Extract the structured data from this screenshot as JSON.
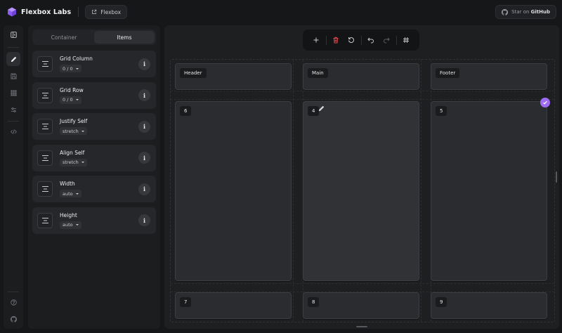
{
  "app": {
    "name": "Flexbox Labs",
    "breadcrumb": "Flexbox"
  },
  "github": {
    "prefix": "Star on ",
    "name": "GitHub"
  },
  "rail": {
    "items": [
      {
        "icon": "panel-toggle-icon"
      },
      {
        "icon": "pencil-icon",
        "active": true
      },
      {
        "icon": "save-icon"
      },
      {
        "icon": "grid-icon"
      },
      {
        "icon": "sliders-icon"
      },
      {
        "icon": "code-icon"
      },
      {
        "icon": "help-icon"
      },
      {
        "icon": "github-icon"
      }
    ]
  },
  "panel": {
    "tabs": [
      {
        "label": "Container",
        "active": false
      },
      {
        "label": "Items",
        "active": true
      }
    ],
    "props": [
      {
        "label": "Grid Column",
        "value": "0 / 0"
      },
      {
        "label": "Grid Row",
        "value": "0 / 0"
      },
      {
        "label": "Justify Self",
        "value": "stretch"
      },
      {
        "label": "Align Self",
        "value": "stretch"
      },
      {
        "label": "Width",
        "value": "auto"
      },
      {
        "label": "Height",
        "value": "auto"
      }
    ],
    "info_glyph": "i"
  },
  "toolbar": {
    "buttons": [
      "plus-icon",
      "trash-icon",
      "reset-icon",
      "undo-icon",
      "redo-icon",
      "hash-grid-icon"
    ]
  },
  "grid": {
    "cells": [
      {
        "label": "Header"
      },
      {
        "label": "Main"
      },
      {
        "label": "Footer"
      },
      {
        "label": "6"
      },
      {
        "label": "4",
        "selected": true
      },
      {
        "label": "5"
      },
      {
        "label": "7"
      },
      {
        "label": "8"
      },
      {
        "label": "9"
      }
    ]
  },
  "colors": {
    "accent": "#9d6cf3",
    "danger": "#e5484d",
    "background": "#161718",
    "panel": "#1c1d1f",
    "cell": "#2a2c2f"
  }
}
